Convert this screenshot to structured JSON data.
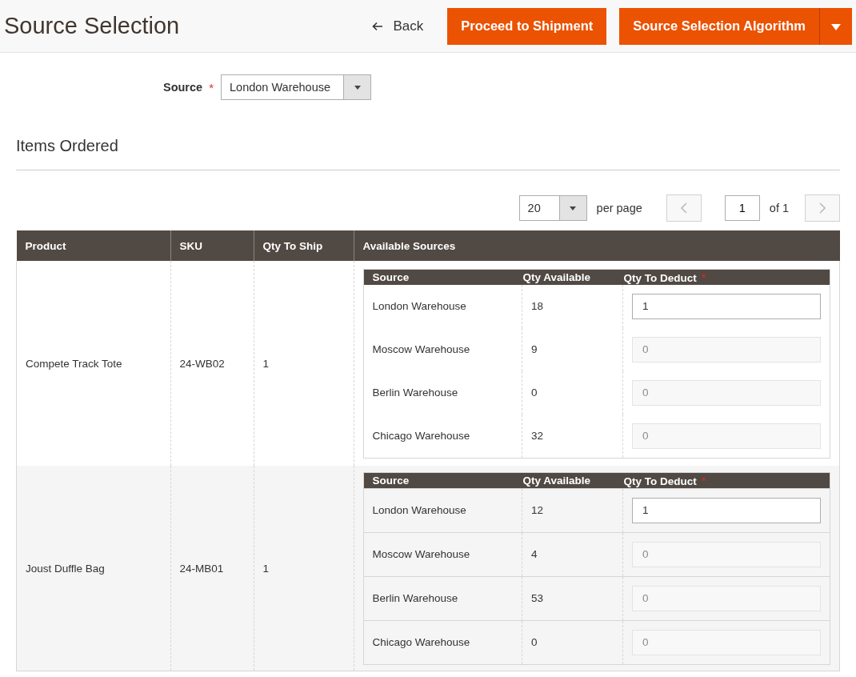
{
  "header": {
    "title": "Source Selection",
    "back": "Back",
    "primary_button": "Proceed to Shipment",
    "split_button": "Source Selection Algorithm"
  },
  "source_field": {
    "label": "Source",
    "required_mark": "*",
    "value": "London Warehouse"
  },
  "section_title": "Items Ordered",
  "pager": {
    "per_page_value": "20",
    "per_page_label": "per page",
    "page": "1",
    "of": "of 1"
  },
  "table": {
    "columns": [
      "Product",
      "SKU",
      "Qty To Ship",
      "Available Sources"
    ],
    "rows": [
      {
        "product": "Compete Track Tote",
        "sku": "24-WB02",
        "qty": "1",
        "sub_columns": [
          "Source",
          "Qty Available",
          "Qty To Deduct"
        ],
        "required_mark": "*",
        "sources": [
          {
            "source": "London Warehouse",
            "available": "18",
            "deduct": "1",
            "disabled": false
          },
          {
            "source": "Moscow Warehouse",
            "available": "9",
            "deduct": "0",
            "disabled": true
          },
          {
            "source": "Berlin Warehouse",
            "available": "0",
            "deduct": "0",
            "disabled": true
          },
          {
            "source": "Chicago Warehouse",
            "available": "32",
            "deduct": "0",
            "disabled": true
          }
        ]
      },
      {
        "product": "Joust Duffle Bag",
        "sku": "24-MB01",
        "qty": "1",
        "sub_columns": [
          "Source",
          "Qty Available",
          "Qty To Deduct"
        ],
        "required_mark": "*",
        "sources": [
          {
            "source": "London Warehouse",
            "available": "12",
            "deduct": "1",
            "disabled": false
          },
          {
            "source": "Moscow Warehouse",
            "available": "4",
            "deduct": "0",
            "disabled": true
          },
          {
            "source": "Berlin Warehouse",
            "available": "53",
            "deduct": "0",
            "disabled": true
          },
          {
            "source": "Chicago Warehouse",
            "available": "0",
            "deduct": "0",
            "disabled": true
          }
        ]
      }
    ]
  }
}
